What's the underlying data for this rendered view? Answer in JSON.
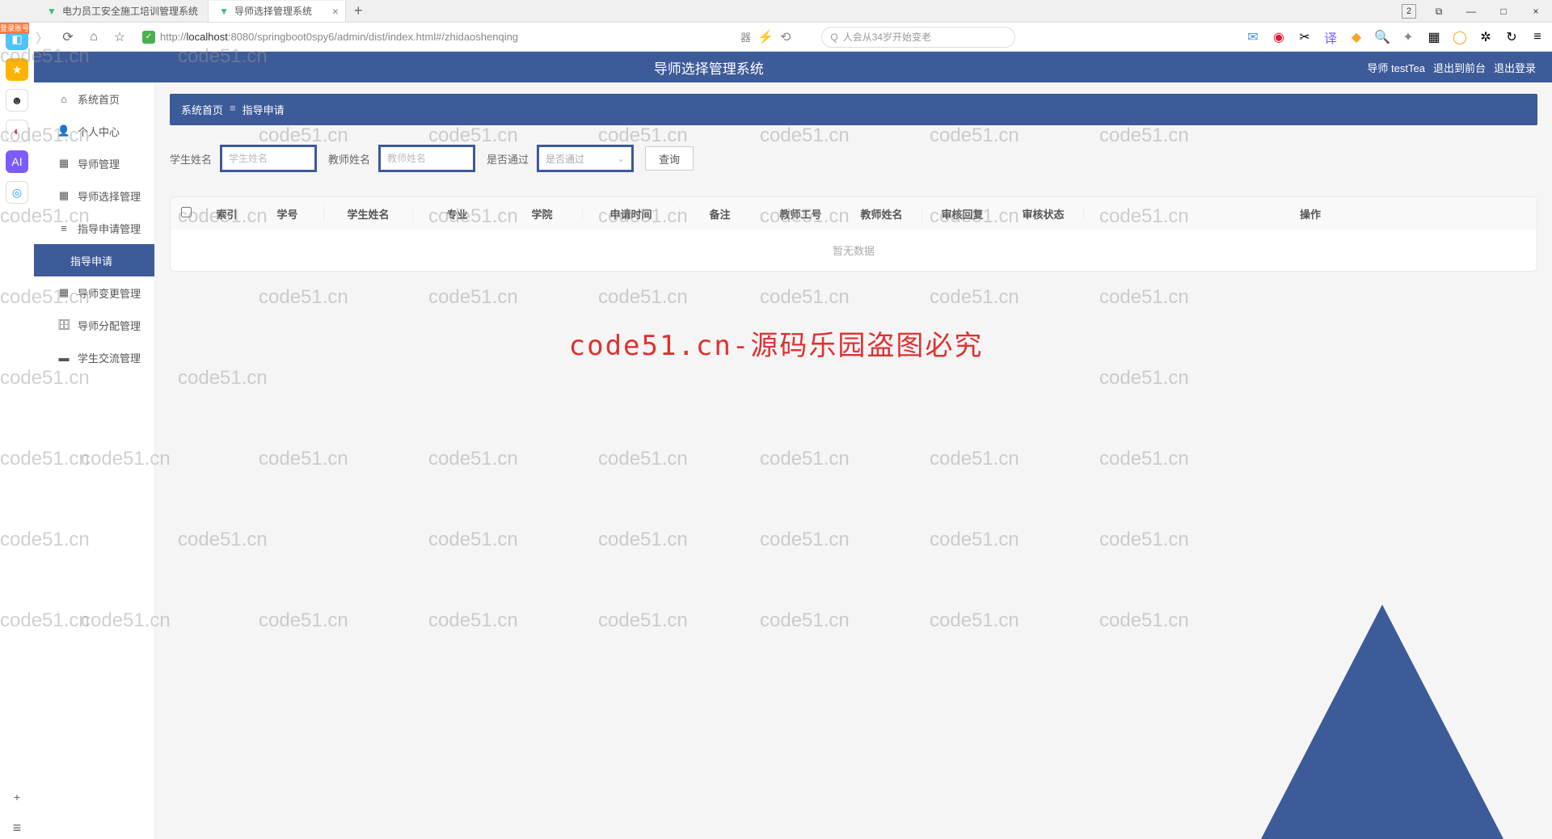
{
  "browser": {
    "tabs": [
      {
        "title": "电力员工安全施工培训管理系统"
      },
      {
        "title": "导师选择管理系统"
      }
    ],
    "url_prefix": "http://",
    "url_host": "localhost",
    "url_port": ":8080",
    "url_path": "/springboot0spy6/admin/dist/index.html#/zhidaoshenqing",
    "search_placeholder": "人会从34岁开始变老",
    "corner_badge": "登录账号"
  },
  "window": {
    "count_badge": "2"
  },
  "app": {
    "title": "导师选择管理系统",
    "user_role": "导师",
    "user_name": "testTea",
    "back_front": "退出到前台",
    "logout": "退出登录"
  },
  "sidebar": {
    "items": [
      {
        "label": "系统首页",
        "icon": "home"
      },
      {
        "label": "个人中心",
        "icon": "user"
      },
      {
        "label": "导师管理",
        "icon": "grid"
      },
      {
        "label": "导师选择管理",
        "icon": "grid"
      },
      {
        "label": "指导申请管理",
        "icon": "list"
      },
      {
        "label": "指导申请",
        "icon": "",
        "active": true,
        "sub": true
      },
      {
        "label": "导师变更管理",
        "icon": "grid"
      },
      {
        "label": "导师分配管理",
        "icon": "briefcase"
      },
      {
        "label": "学生交流管理",
        "icon": "chat"
      }
    ]
  },
  "breadcrumb": {
    "home": "系统首页",
    "current": "指导申请"
  },
  "filters": {
    "student_label": "学生姓名",
    "student_placeholder": "学生姓名",
    "teacher_label": "教师姓名",
    "teacher_placeholder": "教师姓名",
    "pass_label": "是否通过",
    "pass_placeholder": "是否通过",
    "query_btn": "查询"
  },
  "table": {
    "columns": [
      "索引",
      "学号",
      "学生姓名",
      "专业",
      "学院",
      "申请时间",
      "备注",
      "教师工号",
      "教师姓名",
      "审核回复",
      "审核状态",
      "操作"
    ],
    "empty_text": "暂无数据"
  },
  "watermark": {
    "text": "code51.cn",
    "big_text": "code51.cn-源码乐园盗图必究"
  }
}
